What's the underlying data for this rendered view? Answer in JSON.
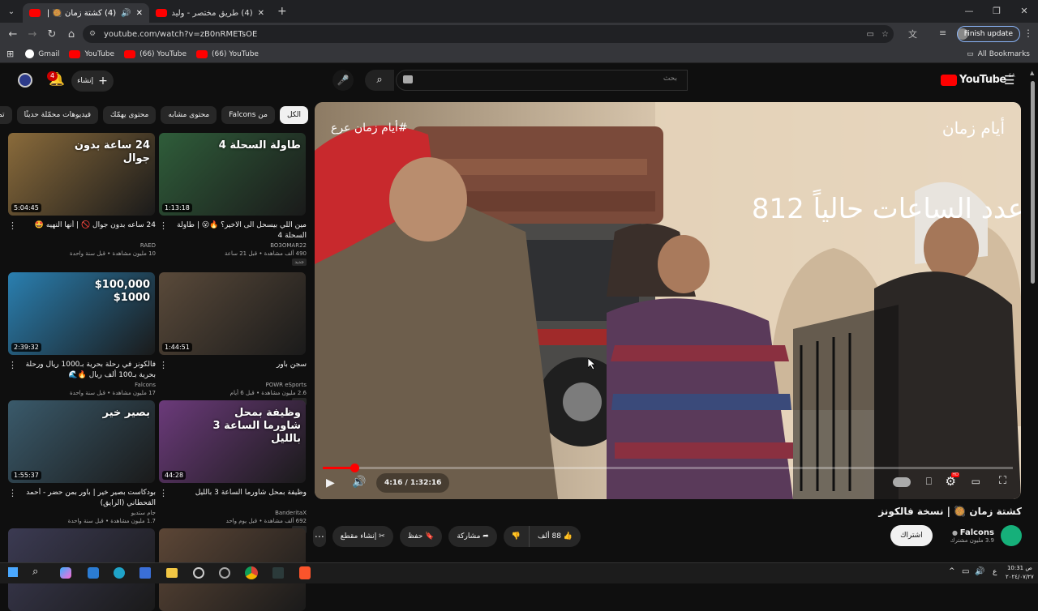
{
  "browser": {
    "tabs": [
      {
        "title": "(4) كشتة زمان 🥘 | نسخة فالـ",
        "active": true
      },
      {
        "title": "(4) طريق مختصر - وليد قصص",
        "active": false
      }
    ],
    "new_tab": "+",
    "url": "youtube.com/watch?v=zB0nRMETsOE",
    "finish_update": "Finish update",
    "bookmarks": [
      "Gmail",
      "YouTube",
      "(66) YouTube",
      "(66) YouTube"
    ],
    "all_bookmarks": "All Bookmarks"
  },
  "header": {
    "logo": "YouTube",
    "logo_region": "SA",
    "search_placeholder": "بحث",
    "create_label": "إنشاء",
    "notif_count": "4"
  },
  "chips": [
    "الكل",
    "من Falcons",
    "محتوى مشابه",
    "محتوى يهمّك",
    "فيديوهات محمّلة حديثًا",
    "تمت"
  ],
  "recommendations": [
    {
      "title": "مين اللي بيسحل الى الاخير؟ 🔥😮 | طاولة السحلة 4",
      "channel": "BO3OMAR22",
      "meta": "490 ألف مشاهدة • قبل 21 ساعة",
      "badge": "جديد",
      "duration": "1:13:18",
      "thumb_text": "طاولة السحلة 4",
      "color": "#2f5d3a"
    },
    {
      "title": "24 ساعه بدون جوال 🚫 | أنها النهيه 🤩",
      "channel": "RAED",
      "meta": "10 مليون مشاهدة • قبل سنة واحدة",
      "badge": "",
      "duration": "5:04:45",
      "thumb_text": "24 ساعة بدون جوال",
      "color": "#8a6b3b"
    },
    {
      "title": "سجن باور",
      "channel": "POWR eSports",
      "meta": "2.6 مليون مشاهدة • قبل 6 أيام",
      "badge": "جديد",
      "duration": "1:44:51",
      "thumb_text": "",
      "color": "#5a4a3a"
    },
    {
      "title": "فالكونز في رحلة بحرية بـ1000 ريال ورحلة بحرية بـ100 ألف ريال 🔥🌊",
      "channel": "Falcons",
      "meta": "17 مليون مشاهدة • قبل سنة واحدة",
      "badge": "",
      "duration": "2:39:32",
      "thumb_text": "$100,000 $1000",
      "color": "#2a7fb0"
    },
    {
      "title": "وظيفة بمحل شاورما الساعة 3 بالليل",
      "channel": "BanderitaX",
      "meta": "692 ألف مشاهدة • قبل يوم واحد",
      "badge": "جديد",
      "duration": "44:28",
      "thumb_text": "وظيفة بمحل شاورما الساعة 3 بالليل",
      "color": "#6b3a7a"
    },
    {
      "title": "بودكاست بصير خير | باور بمن حضر - أحمد القحطاني (الرايق)",
      "channel": "جام ستديو",
      "meta": "1.7 مليون مشاهدة • قبل سنة واحدة",
      "badge": "",
      "duration": "1:55:37",
      "thumb_text": "بصير خير",
      "color": "#3a5a6b"
    },
    {
      "title": "",
      "channel": "",
      "meta": "",
      "badge": "",
      "duration": "",
      "thumb_text": "",
      "color": "#3b3a52"
    },
    {
      "title": "",
      "channel": "",
      "meta": "",
      "badge": "",
      "duration": "",
      "thumb_text": "",
      "color": "#5c4636"
    }
  ],
  "player": {
    "overlay_text": "عدد الساعات حالياً 812",
    "watermark": "أيام زمان",
    "hashtag": "#أيام زمان عرع",
    "time": "4:16 / 1:32:16",
    "progress": 0.046,
    "settings_badge": "HD"
  },
  "video": {
    "title": "كشتة زمان 🥘 | نسخة فالكونز",
    "channel": "Falcons",
    "subs": "3.9 مليون مشترك",
    "subscribe": "اشتراك",
    "likes": "88 ألف",
    "share": "مشاركة",
    "save": "حفظ",
    "clip": "إنشاء مقطع"
  },
  "taskbar": {
    "time": "10:31 ص",
    "date": "٢٠٢٤/٠٧/٢٧",
    "lang": "ع"
  }
}
